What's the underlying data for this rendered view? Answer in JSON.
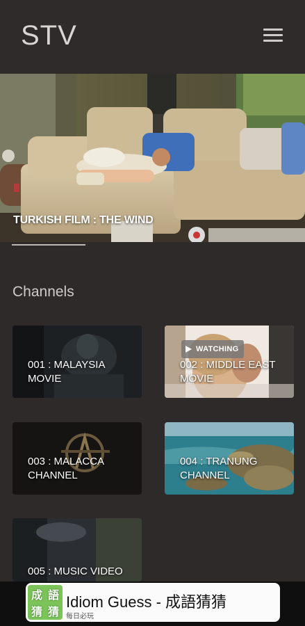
{
  "app": {
    "title": "STV"
  },
  "hero": {
    "title": "TURKISH FILM : THE WIND"
  },
  "channels_section": {
    "title": "Channels"
  },
  "channels": [
    {
      "label": "001 : MALAYSIA MOVIE"
    },
    {
      "label": "002 : MIDDLE EAST MOVIE",
      "badge": "WATCHING"
    },
    {
      "label": "003 : MALACCA CHANNEL"
    },
    {
      "label": "004 : TRANUNG CHANNEL"
    },
    {
      "label": "005 : MUSIC VIDEO"
    }
  ],
  "ad": {
    "logo_chars": [
      "成",
      "語",
      "猜",
      "猜"
    ],
    "title": "Idiom Guess - 成語猜猜",
    "subtitle": "每日必玩"
  },
  "colors": {
    "background": "#2e2a29",
    "text": "#e9e6e4",
    "ad_background": "#fbfbfb"
  }
}
